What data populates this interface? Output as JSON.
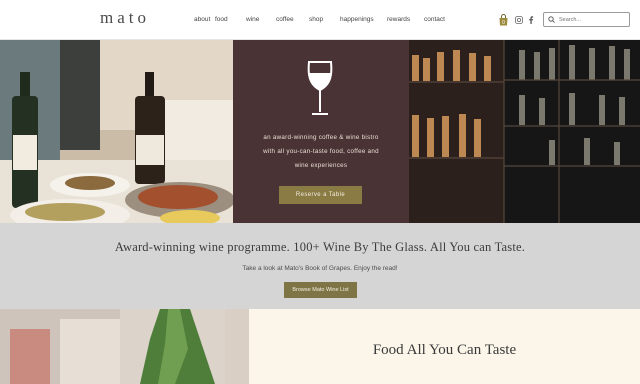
{
  "header": {
    "logo": "mato",
    "nav": [
      "about",
      "food",
      "wine",
      "coffee",
      "shop",
      "happenings",
      "rewards",
      "contact"
    ],
    "icons": [
      "shopping-bag-icon",
      "instagram-icon",
      "facebook-icon"
    ],
    "search": {
      "placeholder": "Search..."
    }
  },
  "hero": {
    "text_line1": "an award-winning coffee & wine bistro",
    "text_line2": "with all you-can-taste food, coffee and",
    "text_line3": "wine experiences",
    "button": "Reserve a Table"
  },
  "band": {
    "title": "Award-winning wine programme. 100+ Wine By The Glass. All You can Taste.",
    "subtitle": "Take a look at Mato's Book of Grapes. Enjoy the read!",
    "button": "Browse Mato Wine List"
  },
  "bottom": {
    "title": "Food All You Can Taste"
  },
  "colors": {
    "hero_mid_bg": "#4a3334",
    "button_bg": "#8a7a43",
    "band_bg": "#d5d5d5",
    "bottom_right_bg": "#fbf6e9"
  }
}
